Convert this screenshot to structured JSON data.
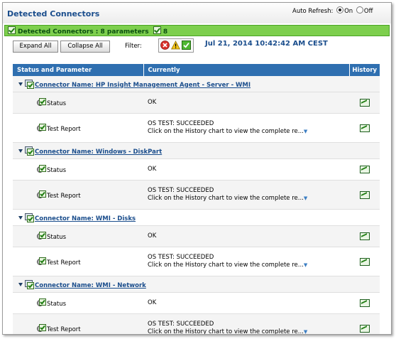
{
  "header": {
    "title": "Detected Connectors",
    "auto_refresh_label": "Auto Refresh:",
    "on_label": "On",
    "off_label": "Off",
    "auto_refresh_value": "On"
  },
  "summary": {
    "text": "Detected Connectors : 8 parameters",
    "ok_count": "8"
  },
  "toolbar": {
    "expand_all": "Expand All",
    "collapse_all": "Collapse All",
    "filter_label": "Filter:",
    "timestamp": "Jul 21, 2014 10:42:42 AM CEST"
  },
  "table": {
    "columns": [
      "Status and Parameter",
      "Currently",
      "History"
    ],
    "connectors": [
      {
        "name": "Connector Name: HP Insight Management Agent - Server - WMI",
        "params": [
          {
            "label": "Status",
            "line1": "OK",
            "line2": ""
          },
          {
            "label": "Test Report",
            "line1": "OS TEST: SUCCEEDED",
            "line2": "Click on the History chart to view the complete re..."
          }
        ]
      },
      {
        "name": "Connector Name: Windows - DiskPart",
        "params": [
          {
            "label": "Status",
            "line1": "OK",
            "line2": ""
          },
          {
            "label": "Test Report",
            "line1": "OS TEST: SUCCEEDED",
            "line2": "Click on the History chart to view the complete re..."
          }
        ]
      },
      {
        "name": "Connector Name: WMI - Disks",
        "params": [
          {
            "label": "Status",
            "line1": "OK",
            "line2": ""
          },
          {
            "label": "Test Report",
            "line1": "OS TEST: SUCCEEDED",
            "line2": "Click on the History chart to view the complete re..."
          }
        ]
      },
      {
        "name": "Connector Name: WMI - Network",
        "params": [
          {
            "label": "Status",
            "line1": "OK",
            "line2": ""
          },
          {
            "label": "Test Report",
            "line1": "OS TEST: SUCCEEDED",
            "line2": "Click on the History chart to view the complete re..."
          }
        ]
      }
    ]
  },
  "colors": {
    "title_blue": "#1a4d8c",
    "header_blue": "#2f6fb0",
    "summary_green": "#7dcf4d"
  }
}
